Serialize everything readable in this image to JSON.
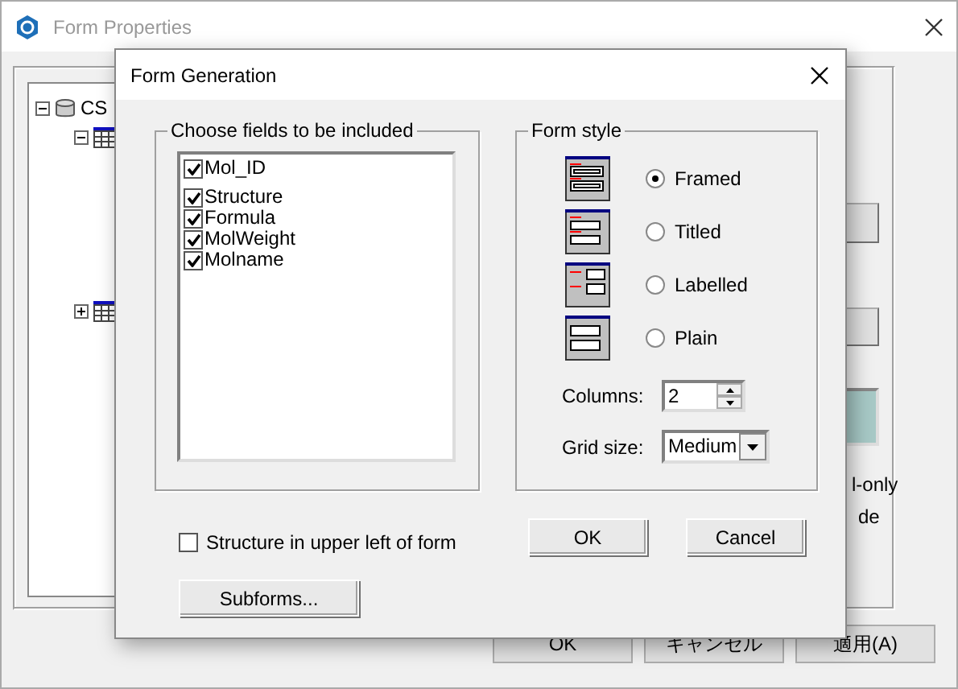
{
  "main_window": {
    "title": "Form Properties",
    "tree": [
      {
        "label": "CS",
        "kind": "database",
        "expanded": true,
        "children": [
          {
            "kind": "table",
            "expanded": true
          },
          {
            "kind": "table",
            "expanded": false
          }
        ]
      }
    ],
    "side_labels": [
      "l-only",
      "de"
    ],
    "buttons": [
      "OK",
      "キャンセル",
      "適用(A)"
    ]
  },
  "dialog": {
    "title": "Form Generation",
    "fields_group": {
      "title": "Choose fields to be included",
      "fields": [
        {
          "label": "Mol_ID",
          "checked": true
        },
        {
          "label": "Structure",
          "checked": true
        },
        {
          "label": "Formula",
          "checked": true
        },
        {
          "label": "MolWeight",
          "checked": true
        },
        {
          "label": "Molname",
          "checked": true
        }
      ]
    },
    "style_group": {
      "title": "Form style",
      "styles": [
        {
          "kind": "framed",
          "label": "Framed",
          "selected": true
        },
        {
          "kind": "titled",
          "label": "Titled",
          "selected": false
        },
        {
          "kind": "labelled",
          "label": "Labelled",
          "selected": false
        },
        {
          "kind": "plain",
          "label": "Plain",
          "selected": false
        }
      ],
      "columns": {
        "label": "Columns:",
        "value": "2"
      },
      "grid_size": {
        "label": "Grid size:",
        "value": "Medium"
      }
    },
    "structure_option": {
      "label": "Structure in upper left of form",
      "checked": false
    },
    "buttons": {
      "subforms": "Subforms...",
      "ok": "OK",
      "cancel": "Cancel"
    }
  }
}
